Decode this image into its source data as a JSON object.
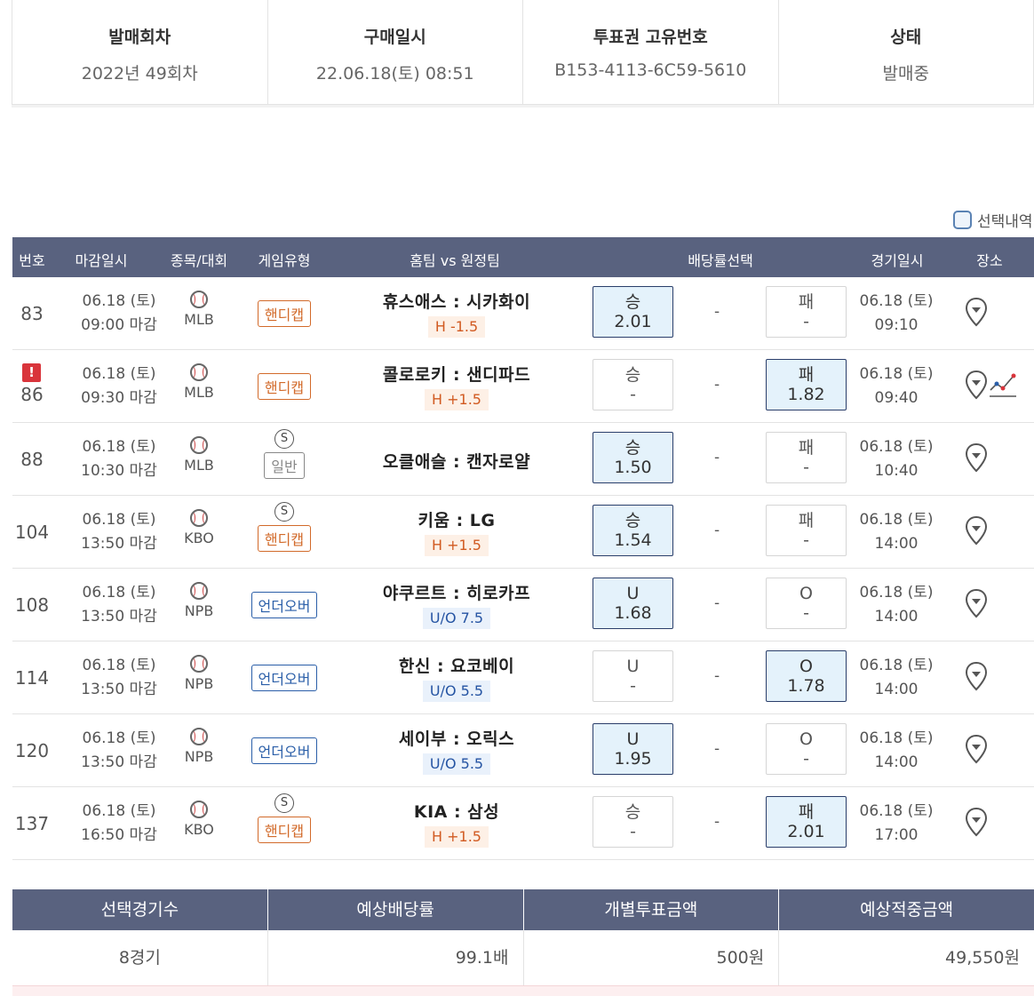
{
  "info": [
    {
      "label": "발매회차",
      "value": "2022년 49회차"
    },
    {
      "label": "구매일시",
      "value": "22.06.18(토) 08:51"
    },
    {
      "label": "투표권 고유번호",
      "value": "B153-4113-6C59-5610"
    },
    {
      "label": "상태",
      "value": "발매중"
    }
  ],
  "select_history_label": "선택내역",
  "table_headers": {
    "no": "번호",
    "deadline": "마감일시",
    "sport": "종목/대회",
    "game_type": "게임유형",
    "teams": "홈팀 vs 원정팀",
    "odds": "배당률선택",
    "game_time": "경기일시",
    "venue": "장소"
  },
  "rows": [
    {
      "no": "83",
      "alert": "",
      "deadline_date": "06.18 (토)",
      "deadline_time": "09:00 마감",
      "sport": "MLB",
      "s": "",
      "type": "핸디캡",
      "type_class": "hc",
      "teams": "휴스애스 : 시카화이",
      "hval": "H -1.5",
      "hval_class": "h",
      "left_label": "승",
      "left_val": "2.01",
      "left_sel": true,
      "mid": "-",
      "right_label": "패",
      "right_val": "-",
      "right_sel": false,
      "game_date": "06.18 (토)",
      "game_time": "09:10",
      "trend": false
    },
    {
      "no": "86",
      "alert": "!",
      "deadline_date": "06.18 (토)",
      "deadline_time": "09:30 마감",
      "sport": "MLB",
      "s": "",
      "type": "핸디캡",
      "type_class": "hc",
      "teams": "콜로로키 : 샌디파드",
      "hval": "H +1.5",
      "hval_class": "h",
      "left_label": "승",
      "left_val": "-",
      "left_sel": false,
      "mid": "-",
      "right_label": "패",
      "right_val": "1.82",
      "right_sel": true,
      "game_date": "06.18 (토)",
      "game_time": "09:40",
      "trend": true
    },
    {
      "no": "88",
      "alert": "",
      "deadline_date": "06.18 (토)",
      "deadline_time": "10:30 마감",
      "sport": "MLB",
      "s": "S",
      "type": "일반",
      "type_class": "gen",
      "teams": "오클애슬 : 캔자로얄",
      "hval": "",
      "hval_class": "",
      "left_label": "승",
      "left_val": "1.50",
      "left_sel": true,
      "mid": "-",
      "right_label": "패",
      "right_val": "-",
      "right_sel": false,
      "game_date": "06.18 (토)",
      "game_time": "10:40",
      "trend": false
    },
    {
      "no": "104",
      "alert": "",
      "deadline_date": "06.18 (토)",
      "deadline_time": "13:50 마감",
      "sport": "KBO",
      "s": "S",
      "type": "핸디캡",
      "type_class": "hc",
      "teams": "키움 : LG",
      "hval": "H +1.5",
      "hval_class": "h",
      "left_label": "승",
      "left_val": "1.54",
      "left_sel": true,
      "mid": "-",
      "right_label": "패",
      "right_val": "-",
      "right_sel": false,
      "game_date": "06.18 (토)",
      "game_time": "14:00",
      "trend": false
    },
    {
      "no": "108",
      "alert": "",
      "deadline_date": "06.18 (토)",
      "deadline_time": "13:50 마감",
      "sport": "NPB",
      "s": "",
      "type": "언더오버",
      "type_class": "uo",
      "teams": "야쿠르트 : 히로카프",
      "hval": "U/O 7.5",
      "hval_class": "uo",
      "left_label": "U",
      "left_val": "1.68",
      "left_sel": true,
      "mid": "-",
      "right_label": "O",
      "right_val": "-",
      "right_sel": false,
      "game_date": "06.18 (토)",
      "game_time": "14:00",
      "trend": false
    },
    {
      "no": "114",
      "alert": "",
      "deadline_date": "06.18 (토)",
      "deadline_time": "13:50 마감",
      "sport": "NPB",
      "s": "",
      "type": "언더오버",
      "type_class": "uo",
      "teams": "한신 : 요코베이",
      "hval": "U/O 5.5",
      "hval_class": "uo",
      "left_label": "U",
      "left_val": "-",
      "left_sel": false,
      "mid": "-",
      "right_label": "O",
      "right_val": "1.78",
      "right_sel": true,
      "game_date": "06.18 (토)",
      "game_time": "14:00",
      "trend": false
    },
    {
      "no": "120",
      "alert": "",
      "deadline_date": "06.18 (토)",
      "deadline_time": "13:50 마감",
      "sport": "NPB",
      "s": "",
      "type": "언더오버",
      "type_class": "uo",
      "teams": "세이부 : 오릭스",
      "hval": "U/O 5.5",
      "hval_class": "uo",
      "left_label": "U",
      "left_val": "1.95",
      "left_sel": true,
      "mid": "-",
      "right_label": "O",
      "right_val": "-",
      "right_sel": false,
      "game_date": "06.18 (토)",
      "game_time": "14:00",
      "trend": false
    },
    {
      "no": "137",
      "alert": "",
      "deadline_date": "06.18 (토)",
      "deadline_time": "16:50 마감",
      "sport": "KBO",
      "s": "S",
      "type": "핸디캡",
      "type_class": "hc",
      "teams": "KIA : 삼성",
      "hval": "H +1.5",
      "hval_class": "h",
      "left_label": "승",
      "left_val": "-",
      "left_sel": false,
      "mid": "-",
      "right_label": "패",
      "right_val": "2.01",
      "right_sel": true,
      "game_date": "06.18 (토)",
      "game_time": "17:00",
      "trend": false
    }
  ],
  "summary": {
    "headers": [
      "선택경기수",
      "예상배당률",
      "개별투표금액",
      "예상적중금액"
    ],
    "values": [
      "8경기",
      "99.1배",
      "500원",
      "49,550원"
    ]
  },
  "colors": {
    "header_bg": "#59627f",
    "selected_bg": "#e4f2fb",
    "handicap": "#d26a2a",
    "underover": "#2a5ea8",
    "alert": "#d9343b"
  }
}
